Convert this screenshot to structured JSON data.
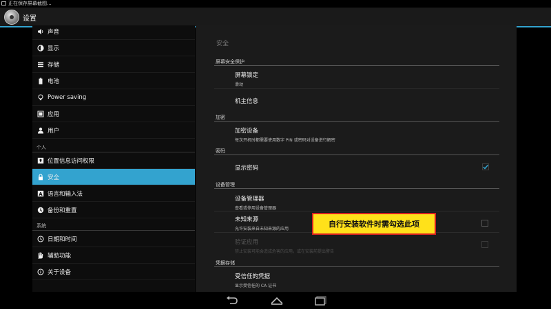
{
  "status_bar": {
    "notification": "正在保存屏幕截图..."
  },
  "action_bar": {
    "title": "设置"
  },
  "sidebar": {
    "items": [
      {
        "label": "声音",
        "icon": "volume-icon"
      },
      {
        "label": "显示",
        "icon": "brightness-icon"
      },
      {
        "label": "存储",
        "icon": "storage-icon"
      },
      {
        "label": "电池",
        "icon": "battery-icon"
      },
      {
        "label": "Power saving",
        "icon": "bulb-icon"
      },
      {
        "label": "应用",
        "icon": "apps-icon"
      },
      {
        "label": "用户",
        "icon": "user-icon"
      }
    ],
    "section_personal": "个人",
    "personal_items": [
      {
        "label": "位置信息访问权限",
        "icon": "location-icon"
      },
      {
        "label": "安全",
        "icon": "lock-icon",
        "active": true
      },
      {
        "label": "语言和输入法",
        "icon": "language-icon"
      },
      {
        "label": "备份和重置",
        "icon": "backup-icon"
      }
    ],
    "section_system": "系统",
    "system_items": [
      {
        "label": "日期和时间",
        "icon": "clock-icon"
      },
      {
        "label": "辅助功能",
        "icon": "hand-icon"
      },
      {
        "label": "关于设备",
        "icon": "info-icon"
      }
    ],
    "accent_color": "#33a3cf"
  },
  "content": {
    "title": "安全",
    "sections": {
      "screen_security": "屏幕安全保护",
      "encryption": "加密",
      "passwords": "密码",
      "device_admin": "设备管理",
      "credential_storage": "凭据存储"
    },
    "prefs": {
      "screen_lock": {
        "title": "屏幕锁定",
        "summary": "滑动"
      },
      "owner_info": {
        "title": "机主信息"
      },
      "encrypt": {
        "title": "加密设备",
        "summary": "每次开机时都需要使用数字 PIN 或密码对设备进行解密"
      },
      "show_password": {
        "title": "显示密码",
        "checked": true
      },
      "device_admins": {
        "title": "设备管理器",
        "summary": "查看或停用设备管理器"
      },
      "unknown_sources": {
        "title": "未知来源",
        "summary": "允许安装来自未知来源的应用",
        "checked": false
      },
      "verify_apps": {
        "title": "验证应用",
        "summary": "禁止安装可能会造成危害的应用，或在安装前提出警告",
        "checked": false,
        "disabled": true
      },
      "trusted_credentials": {
        "title": "受信任的凭据",
        "summary": "显示受信任的 CA 证书"
      }
    }
  },
  "callout": {
    "text": "自行安装软件时需勾选此项"
  },
  "nav_bar": {
    "buttons": [
      "back-icon",
      "home-icon",
      "recents-icon"
    ]
  }
}
